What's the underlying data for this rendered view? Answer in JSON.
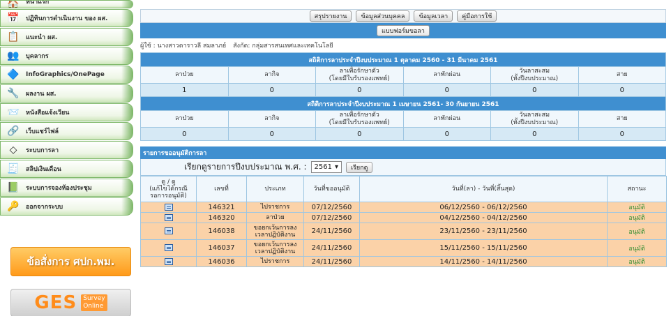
{
  "sidebar": {
    "items": [
      {
        "label": "หน้าแรก",
        "icon": "home-icon",
        "glyph": "🏠"
      },
      {
        "label": "ปฏิทินการดำเนินงาน ของ ผส.",
        "icon": "calendar-icon",
        "glyph": "📅"
      },
      {
        "label": "แนะนำ ผส.",
        "icon": "board-icon",
        "glyph": "📋"
      },
      {
        "label": "บุคลากร",
        "icon": "people-icon",
        "glyph": "👥"
      },
      {
        "label": "InfoGraphics/OnePage",
        "icon": "infographic-icon",
        "glyph": "🔷"
      },
      {
        "label": "ผลงาน ผส.",
        "icon": "work-icon",
        "glyph": "🔧"
      },
      {
        "label": "หนังสือแจ้งเวียน",
        "icon": "letter-icon",
        "glyph": "📨"
      },
      {
        "label": "เว็บแชร์ไฟล์",
        "icon": "share-file-icon",
        "glyph": "🔗"
      },
      {
        "label": "ระบบการลา",
        "icon": "leave-system-icon",
        "glyph": "◇"
      },
      {
        "label": "สลิปเงินเดือน",
        "icon": "payslip-icon",
        "glyph": "🧾"
      },
      {
        "label": "ระบบการจองห้องประชุม",
        "icon": "meeting-room-icon",
        "glyph": "📗"
      },
      {
        "label": "ออกจากระบบ",
        "icon": "logout-icon",
        "glyph": "🔑"
      }
    ],
    "banner_order": "ข้อสั่งการ ศปก.พม.",
    "banner_ges": {
      "big": "GES",
      "small1": "Survey",
      "small2": "Online"
    }
  },
  "toolbar": {
    "summary": "สรุปรายงาน",
    "personal": "ข้อมูลส่วนบุคคล",
    "time": "ข้อมูลเวลา",
    "manual": "คู่มือการใช้"
  },
  "form_button": "แบบฟอร์มขอลา",
  "user": {
    "name": "ผู้ใช้ : นางสาวดาราวลี สมลาภย์",
    "dept": "สังกัด: กลุ่มสารสนเทศและเทคโนโลยี"
  },
  "stats": [
    {
      "title": "สถิติการลาประจำปีงบประมาณ 1 ตุลาคม 2560 - 31 มีนาคม 2561",
      "headers": [
        "ลาป่วย",
        "ลากิจ",
        "ลาเพื่อรักษาตัว\n(โดยมีใบรับรองแพทย์)",
        "ลาพักผ่อน",
        "วันลาสะสม\n(ทั้งปีงบประมาณ)",
        "สาย"
      ],
      "values": [
        "1",
        "0",
        "0",
        "0",
        "0",
        "0"
      ]
    },
    {
      "title": "สถิติการลาประจำปีงบประมาณ 1 เมษายน 2561- 30 กันยายน 2561",
      "headers": [
        "ลาป่วย",
        "ลากิจ",
        "ลาเพื่อรักษาตัว\n(โดยมีใบรับรองแพทย์)",
        "ลาพักผ่อน",
        "วันลาสะสม\n(ทั้งปีงบประมาณ)",
        "สาย"
      ],
      "values": [
        "0",
        "0",
        "0",
        "0",
        "0",
        "0"
      ]
    }
  ],
  "leave": {
    "title": "รายการขออนุมัติการลา",
    "search_label": "เรียกดูรายการปีงบประมาณ พ.ศ. :",
    "year": "2561",
    "search_button": "เรียกดู",
    "headers": [
      "ดู / ดู\n(แก้ไขได้กรณี\nรอการอนุมัติ)",
      "เลขที่",
      "ประเภท",
      "วันที่ขออนุมัติ",
      "วันที่(ลา) - วันที่(สิ้นสุด)",
      "สถานะ"
    ],
    "rows": [
      {
        "no": "146321",
        "type": "ไปราชการ",
        "date": "07/12/2560",
        "range": "06/12/2560 - 06/12/2560",
        "status": "อนุมัติ"
      },
      {
        "no": "146320",
        "type": "ลาป่วย",
        "date": "07/12/2560",
        "range": "04/12/2560 - 04/12/2560",
        "status": "อนุมัติ"
      },
      {
        "no": "146038",
        "type": "ขอยกเว้นการลง\nเวลาปฏิบัติงาน",
        "date": "24/11/2560",
        "range": "23/11/2560 - 23/11/2560",
        "status": "อนุมัติ"
      },
      {
        "no": "146037",
        "type": "ขอยกเว้นการลง\nเวลาปฏิบัติงาน",
        "date": "24/11/2560",
        "range": "15/11/2560 - 15/11/2560",
        "status": "อนุมัติ"
      },
      {
        "no": "146036",
        "type": "ไปราชการ",
        "date": "24/11/2560",
        "range": "14/11/2560 - 14/11/2560",
        "status": "อนุมัติ"
      }
    ]
  }
}
